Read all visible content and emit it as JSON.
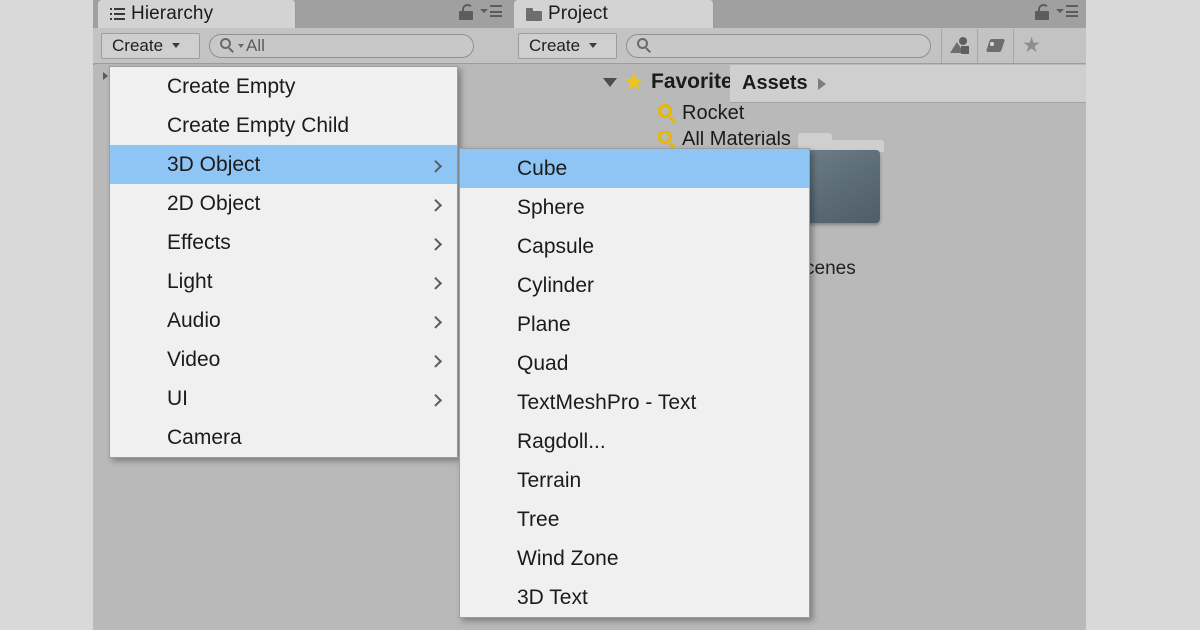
{
  "window": {
    "background_color": "#d9d9d9",
    "panel_background": "#b9b9b9",
    "accent_highlight": "#8ec5f5"
  },
  "hierarchy_panel": {
    "tab_label": "Hierarchy",
    "tab_icon": "hierarchy-list-icon",
    "lock_icon": "lock-open-icon",
    "options_icon": "panel-options-menu-icon",
    "toolbar": {
      "create_label": "Create",
      "create_caret": "dropdown-caret-icon",
      "search_icon": "search-magnifier-icon",
      "search_value": "All",
      "search_placeholder": "All"
    }
  },
  "project_panel": {
    "tab_label": "Project",
    "tab_icon": "folder-icon",
    "lock_icon": "lock-open-icon",
    "options_icon": "panel-options-menu-icon",
    "toolbar": {
      "create_label": "Create",
      "create_caret": "dropdown-caret-icon",
      "search_icon": "search-magnifier-icon",
      "search_value": "",
      "search_placeholder": "",
      "filter_buttons": [
        {
          "name": "filter-by-type-icon",
          "label": "Filter by Type"
        },
        {
          "name": "filter-by-label-icon",
          "label": "Filter by Label"
        },
        {
          "name": "favorites-star-icon",
          "label": "Favorites"
        }
      ]
    },
    "tree": {
      "favorites": {
        "label": "Favorites",
        "expanded": true,
        "caret_icon": "triangle-down-icon",
        "star_icon": "star-icon",
        "children": [
          {
            "label": "Rocket",
            "icon": "saved-search-icon"
          },
          {
            "label": "All Materials",
            "icon": "saved-search-icon"
          }
        ]
      }
    },
    "breadcrumb": {
      "items": [
        "Assets"
      ],
      "arrow_icon": "breadcrumb-arrow-icon"
    },
    "assets": [
      {
        "label": "Scenes",
        "icon": "folder-icon",
        "visible_label": "cenes"
      }
    ]
  },
  "create_menu": {
    "items": [
      {
        "label": "Create Empty",
        "has_submenu": false,
        "selected": false
      },
      {
        "label": "Create Empty Child",
        "has_submenu": false,
        "selected": false
      },
      {
        "label": "3D Object",
        "has_submenu": true,
        "selected": true
      },
      {
        "label": "2D Object",
        "has_submenu": true,
        "selected": false
      },
      {
        "label": "Effects",
        "has_submenu": true,
        "selected": false
      },
      {
        "label": "Light",
        "has_submenu": true,
        "selected": false
      },
      {
        "label": "Audio",
        "has_submenu": true,
        "selected": false
      },
      {
        "label": "Video",
        "has_submenu": true,
        "selected": false
      },
      {
        "label": "UI",
        "has_submenu": true,
        "selected": false
      },
      {
        "label": "Camera",
        "has_submenu": false,
        "selected": false
      }
    ]
  },
  "object_submenu": {
    "parent": "3D Object",
    "items": [
      {
        "label": "Cube",
        "selected": true
      },
      {
        "label": "Sphere",
        "selected": false
      },
      {
        "label": "Capsule",
        "selected": false
      },
      {
        "label": "Cylinder",
        "selected": false
      },
      {
        "label": "Plane",
        "selected": false
      },
      {
        "label": "Quad",
        "selected": false
      },
      {
        "label": "TextMeshPro - Text",
        "selected": false
      },
      {
        "label": "Ragdoll...",
        "selected": false
      },
      {
        "label": "Terrain",
        "selected": false
      },
      {
        "label": "Tree",
        "selected": false
      },
      {
        "label": "Wind Zone",
        "selected": false
      },
      {
        "label": "3D Text",
        "selected": false
      }
    ]
  }
}
